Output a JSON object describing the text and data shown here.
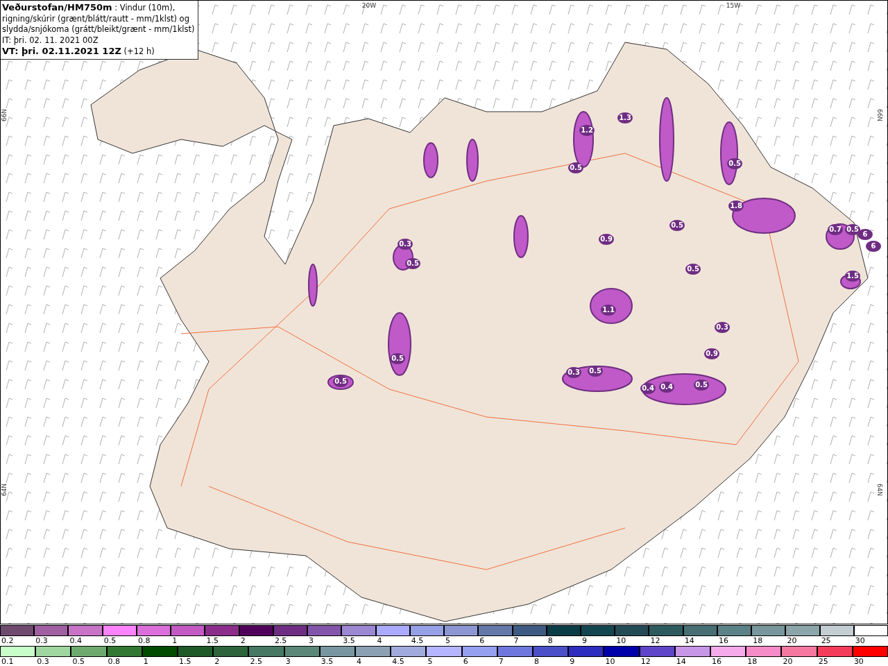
{
  "header": {
    "source": "Veðurstofan/HM750m",
    "description": " : Vindur (10m),",
    "lines": [
      "rigning/skúrir (grænt/blátt/rautt - mm/1klst) og",
      "slydda/snjókoma (grátt/bleikt/grænt - mm/1klst)",
      "IT: þri. 02. 11. 2021 00Z"
    ],
    "valid_time": "VT: þri. 02.11.2021 12Z",
    "offset": " (+12 h)"
  },
  "map": {
    "axis_labels": [
      "20W",
      "15W",
      "66N",
      "66N",
      "64N",
      "64N"
    ],
    "contour_labels": [
      "1.2",
      "1.3",
      "0.5",
      "0.5",
      "0.5",
      "0.9",
      "1.1",
      "0.3",
      "0.5",
      "0.5",
      "0.5",
      "0.3",
      "0.5",
      "0.4",
      "0.4",
      "0.5",
      "0.9",
      "0.3",
      "1.8",
      "0.7",
      "0.5",
      "1.5",
      "0.5",
      "6",
      "6"
    ]
  },
  "legend_snow": [
    {
      "label": "0.2",
      "color": "#6e4a6e"
    },
    {
      "label": "0.3",
      "color": "#a05fa0"
    },
    {
      "label": "0.4",
      "color": "#c873c8"
    },
    {
      "label": "0.5",
      "color": "#ff82ff"
    },
    {
      "label": "0.8",
      "color": "#dc6edc"
    },
    {
      "label": "1",
      "color": "#c35ac3"
    },
    {
      "label": "1.5",
      "color": "#8c2d8c"
    },
    {
      "label": "2",
      "color": "#50005a"
    },
    {
      "label": "2.5",
      "color": "#6e2d82"
    },
    {
      "label": "3",
      "color": "#8255aa"
    },
    {
      "label": "3.5",
      "color": "#9b87d2"
    },
    {
      "label": "4",
      "color": "#aaaaff"
    },
    {
      "label": "4.5",
      "color": "#96a0e6"
    },
    {
      "label": "5",
      "color": "#8c96d2"
    },
    {
      "label": "6",
      "color": "#6478aa"
    },
    {
      "label": "7",
      "color": "#3c5a82"
    },
    {
      "label": "8",
      "color": "#0a3c46"
    },
    {
      "label": "9",
      "color": "#144650"
    },
    {
      "label": "10",
      "color": "#234b55"
    },
    {
      "label": "12",
      "color": "#2d5a5f"
    },
    {
      "label": "14",
      "color": "#466e73"
    },
    {
      "label": "16",
      "color": "#5a8287"
    },
    {
      "label": "18",
      "color": "#78969b"
    },
    {
      "label": "20",
      "color": "#8ca5aa"
    },
    {
      "label": "25",
      "color": "#c3cdd2"
    },
    {
      "label": "30",
      "color": "#ffffff"
    }
  ],
  "legend_rain": [
    {
      "label": "0.1",
      "color": "#c8ffc8"
    },
    {
      "label": "0.3",
      "color": "#a0d7a0"
    },
    {
      "label": "0.5",
      "color": "#6eaa6e"
    },
    {
      "label": "0.8",
      "color": "#327832"
    },
    {
      "label": "1",
      "color": "#004b00"
    },
    {
      "label": "1.5",
      "color": "#1e5a28"
    },
    {
      "label": "2",
      "color": "#2d643c"
    },
    {
      "label": "2.5",
      "color": "#467864"
    },
    {
      "label": "3",
      "color": "#5a8778"
    },
    {
      "label": "3.5",
      "color": "#7896a0"
    },
    {
      "label": "4",
      "color": "#8ca0b4"
    },
    {
      "label": "4.5",
      "color": "#a0aadc"
    },
    {
      "label": "5",
      "color": "#b4b4ff"
    },
    {
      "label": "6",
      "color": "#96a0f0"
    },
    {
      "label": "7",
      "color": "#6e78dc"
    },
    {
      "label": "8",
      "color": "#4b50c8"
    },
    {
      "label": "9",
      "color": "#2d2dbe"
    },
    {
      "label": "10",
      "color": "#0000aa"
    },
    {
      "label": "12",
      "color": "#5f46c8"
    },
    {
      "label": "14",
      "color": "#c896e6"
    },
    {
      "label": "16",
      "color": "#f5aaeb"
    },
    {
      "label": "18",
      "color": "#f58cc8"
    },
    {
      "label": "20",
      "color": "#f578a0"
    },
    {
      "label": "25",
      "color": "#f53c5a"
    },
    {
      "label": "30",
      "color": "#ff0000"
    }
  ]
}
